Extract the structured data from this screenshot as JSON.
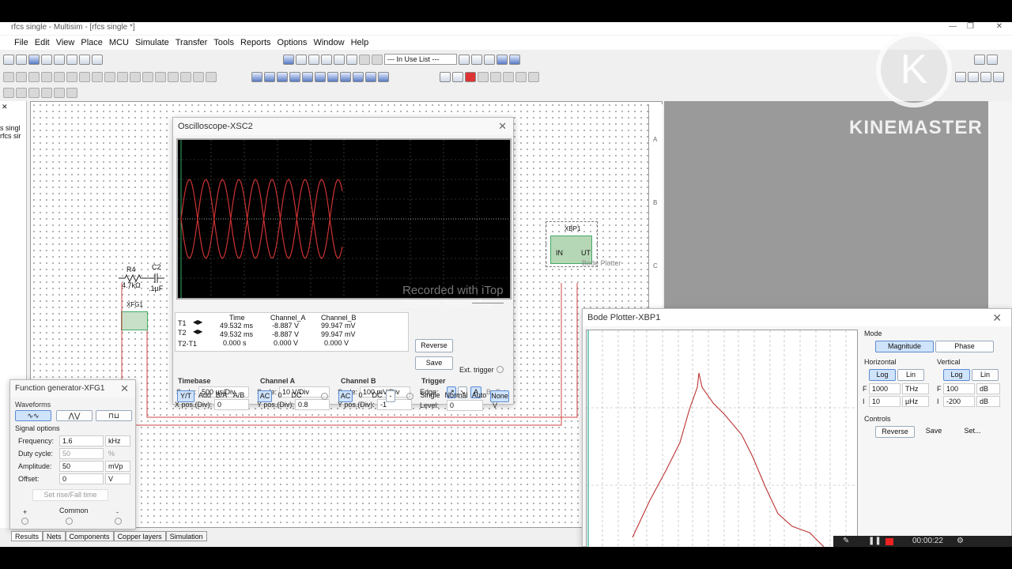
{
  "window": {
    "title": "rfcs single - Multisim - [rfcs single *]",
    "close": "✕",
    "restore": "❐",
    "minimize": "—"
  },
  "menu": [
    "File",
    "Edit",
    "View",
    "Place",
    "MCU",
    "Simulate",
    "Transfer",
    "Tools",
    "Reports",
    "Options",
    "Window",
    "Help"
  ],
  "toolbar": {
    "in_use_list": "--- In Use List ---"
  },
  "sidebar": {
    "tab1": "s singl",
    "tab2": "rfcs sir"
  },
  "schematic": {
    "r4_label": "R4",
    "r4_value": "4.7kΩ",
    "c2_label": "C2",
    "c2_value": ".1µF",
    "xfg_label": "XFG1",
    "xbp_label": "XBP1",
    "xbp_in": "IN",
    "xbp_out": "UT",
    "xbp_caption": "Bode Plotter",
    "border_a": "A",
    "border_b": "B",
    "border_c": "C"
  },
  "watermark": {
    "logo_letter": "K",
    "brand": "KINEMASTER",
    "recorder": "Recorded with iTop Screen Recorder"
  },
  "oscilloscope": {
    "title": "Oscilloscope-XSC2",
    "readout_headers": [
      "Time",
      "Channel_A",
      "Channel_B"
    ],
    "rows": [
      {
        "label": "T1",
        "time": "49.532 ms",
        "a": "-8.887 V",
        "b": "99.947 mV"
      },
      {
        "label": "T2",
        "time": "49.532 ms",
        "a": "-8.887 V",
        "b": "99.947 mV"
      },
      {
        "label": "T2-T1",
        "time": "0.000 s",
        "a": "0.000 V",
        "b": "0.000 V"
      }
    ],
    "reverse": "Reverse",
    "save": "Save",
    "ext_trigger": "Ext. trigger",
    "timebase": {
      "title": "Timebase",
      "scale_label": "Scale:",
      "scale": "500 us/Div",
      "xpos_label": "X pos.(Div):",
      "xpos": "0",
      "buttons": [
        "Y/T",
        "Add",
        "B/A",
        "A/B"
      ]
    },
    "channel_a": {
      "title": "Channel A",
      "scale_label": "Scale:",
      "scale": "10  V/Div",
      "ypos_label": "Y pos.(Div):",
      "ypos": "0.8",
      "buttons": [
        "AC",
        "0",
        "DC"
      ]
    },
    "channel_b": {
      "title": "Channel B",
      "scale_label": "Scale:",
      "scale": "100 mV/Div",
      "ypos_label": "Y pos.(Div):",
      "ypos": "-1",
      "buttons": [
        "AC",
        "0",
        "DC",
        "-"
      ]
    },
    "trigger": {
      "title": "Trigger",
      "edge_label": "Edge:",
      "edge_a": "A",
      "edge_b": "B",
      "edge_ext": "Ext",
      "level_label": "Level:",
      "level": "0",
      "level_unit": "V",
      "modes": [
        "Single",
        "Normal",
        "Auto",
        "None"
      ]
    }
  },
  "function_generator": {
    "title": "Function generator-XFG1",
    "waveforms": "Waveforms",
    "signal_options": "Signal options",
    "frequency_label": "Frequency:",
    "frequency": "1.6",
    "frequency_unit": "kHz",
    "duty_label": "Duty cycle:",
    "duty": "50",
    "duty_unit": "%",
    "amplitude_label": "Amplitude:",
    "amplitude": "50",
    "amplitude_unit": "mVp",
    "offset_label": "Offset:",
    "offset": "0",
    "offset_unit": "V",
    "rise_fall": "Set rise/Fall time",
    "plus": "+",
    "common": "Common",
    "minus": "-"
  },
  "bode": {
    "title": "Bode Plotter-XBP1",
    "mode": "Mode",
    "magnitude": "Magnitude",
    "phase": "Phase",
    "horizontal": "Horizontal",
    "vertical": "Vertical",
    "log": "Log",
    "lin": "Lin",
    "h_f_label": "F",
    "h_f": "1000",
    "h_f_unit": "THz",
    "h_i_label": "I",
    "h_i": "10",
    "h_i_unit": "µHz",
    "v_f_label": "F",
    "v_f": "100",
    "v_f_unit": "dB",
    "v_i_label": "I",
    "v_i": "-200",
    "v_i_unit": "dB",
    "controls": "Controls",
    "reverse": "Reverse",
    "save": "Save",
    "set": "Set..."
  },
  "bottom_tabs": [
    "Results",
    "Nets",
    "Components",
    "Copper layers",
    "Simulation"
  ],
  "recorder_bar": {
    "time": "00:00:22"
  }
}
